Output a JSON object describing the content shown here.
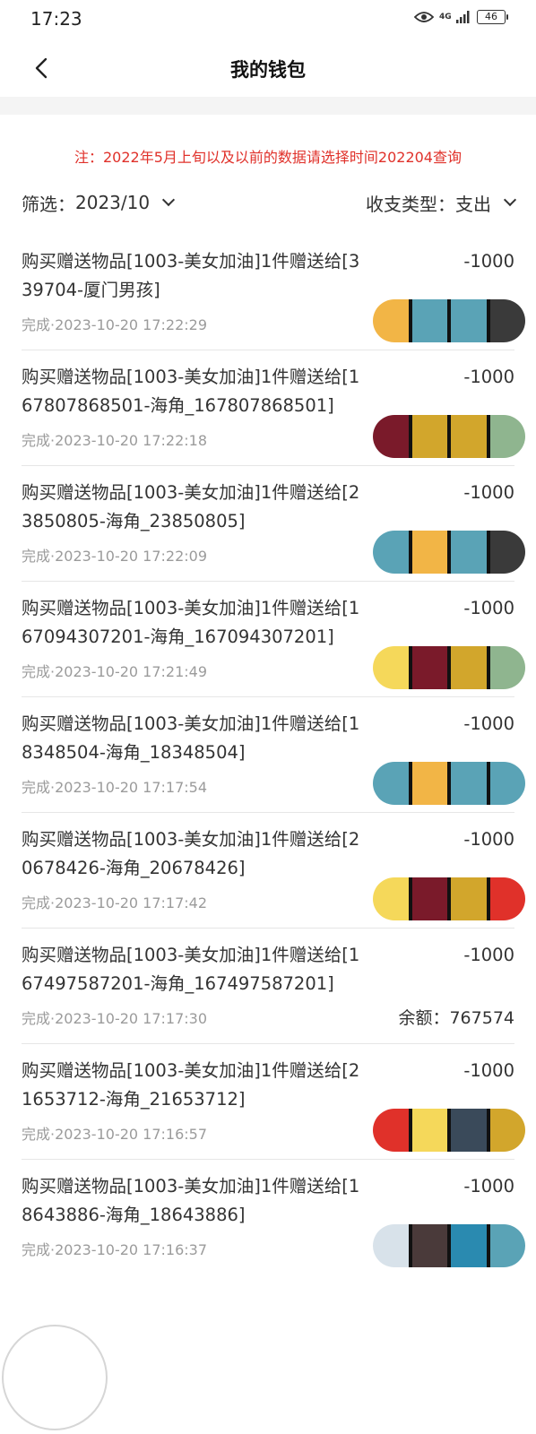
{
  "status_bar": {
    "time": "17:23",
    "network": "4G",
    "battery": "46"
  },
  "nav": {
    "title": "我的钱包"
  },
  "notice": "注：2022年5月上旬以及以前的数据请选择时间202204查询",
  "filter": {
    "date_label": "筛选：",
    "date_value": "2023/10",
    "type_label": "收支类型：",
    "type_value": "支出"
  },
  "transactions": [
    {
      "desc": "购买赠送物品[1003-美女加油]1件赠送给[339704-厦门男孩]",
      "amount": "-1000",
      "time": "完成·2023-10-20 17:22:29",
      "balance": ""
    },
    {
      "desc": "购买赠送物品[1003-美女加油]1件赠送给[167807868501-海角_167807868501]",
      "amount": "-1000",
      "time": "完成·2023-10-20 17:22:18",
      "balance": ""
    },
    {
      "desc": "购买赠送物品[1003-美女加油]1件赠送给[23850805-海角_23850805]",
      "amount": "-1000",
      "time": "完成·2023-10-20 17:22:09",
      "balance": ""
    },
    {
      "desc": "购买赠送物品[1003-美女加油]1件赠送给[167094307201-海角_167094307201]",
      "amount": "-1000",
      "time": "完成·2023-10-20 17:21:49",
      "balance": ""
    },
    {
      "desc": "购买赠送物品[1003-美女加油]1件赠送给[18348504-海角_18348504]",
      "amount": "-1000",
      "time": "完成·2023-10-20 17:17:54",
      "balance": ""
    },
    {
      "desc": "购买赠送物品[1003-美女加油]1件赠送给[20678426-海角_20678426]",
      "amount": "-1000",
      "time": "完成·2023-10-20 17:17:42",
      "balance": ""
    },
    {
      "desc": "购买赠送物品[1003-美女加油]1件赠送给[167497587201-海角_167497587201]",
      "amount": "-1000",
      "time": "完成·2023-10-20 17:17:30",
      "balance": "余额：767574"
    },
    {
      "desc": "购买赠送物品[1003-美女加油]1件赠送给[21653712-海角_21653712]",
      "amount": "-1000",
      "time": "完成·2023-10-20 17:16:57",
      "balance": ""
    },
    {
      "desc": "购买赠送物品[1003-美女加油]1件赠送给[18643886-海角_18643886]",
      "amount": "-1000",
      "time": "完成·2023-10-20 17:16:37",
      "balance": ""
    }
  ],
  "colors": {
    "notice_red": "#e0312a",
    "muted_gray": "#9b9b9b",
    "text": "#333333"
  },
  "icons": {
    "back": "chevron-left-icon",
    "eye": "eye-icon",
    "signal": "signal-icon",
    "battery": "battery-icon",
    "dropdown": "chevron-down-icon"
  }
}
